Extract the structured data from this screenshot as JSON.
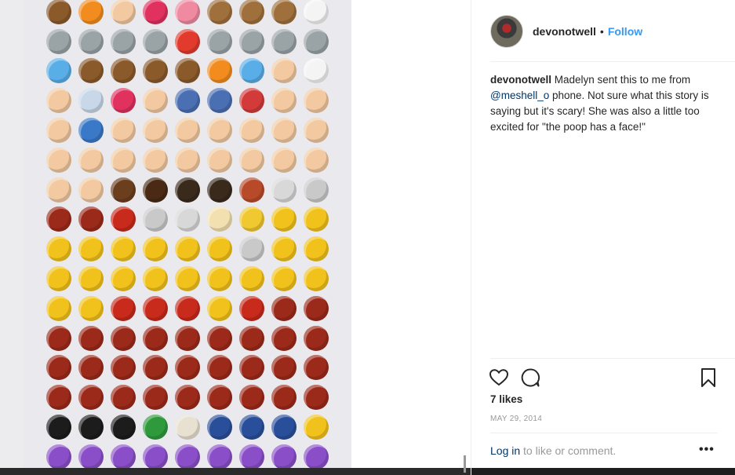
{
  "post": {
    "username": "devonotwell",
    "separator": "•",
    "follow_label": "Follow",
    "caption_username": "devonotwell",
    "caption_before_mention": " Madelyn sent this to me from ",
    "caption_mention": "@meshell_o",
    "caption_after_mention": " phone. Not sure what this story is saying but it's scary! She was also a little too excited for \"the poop has a face!\"",
    "likes": "7 likes",
    "date": "MAY 29, 2014",
    "login_link": "Log in",
    "login_suffix": " to like or comment.",
    "more_label": "•••"
  },
  "icons": {
    "like": "heart-icon",
    "comment": "comment-icon",
    "save": "bookmark-icon",
    "more": "more-options-icon"
  },
  "colors": {
    "accent": "#3897f0",
    "link": "#003569",
    "text": "#262626",
    "muted": "#999999",
    "phone_bg": "#e9e9ee"
  },
  "emoji_rows": [
    [
      "poo",
      "fire",
      "nose",
      "lips",
      "tongue",
      "monkey",
      "monkey",
      "monkey",
      "eyes"
    ],
    [
      "alien",
      "alien",
      "alien",
      "alien",
      "anger",
      "alien",
      "alien",
      "alien",
      "alien"
    ],
    [
      "sweat",
      "poo",
      "poo",
      "poo",
      "poo",
      "fire",
      "droplet",
      "nose",
      "eyes"
    ],
    [
      "ear",
      "dash",
      "lips",
      "wave",
      "runner",
      "runner",
      "dancer",
      "muscle",
      "clap"
    ],
    [
      "point-up",
      "pray",
      "open-hands",
      "open-hands",
      "thumbs-up",
      "ok-hand",
      "fist",
      "fist",
      "fist"
    ],
    [
      "fist",
      "point-down",
      "point-down",
      "point-down",
      "point-down",
      "point-up",
      "muscle",
      "muscle",
      "muscle"
    ],
    [
      "muscle",
      "baby",
      "boy",
      "girl",
      "man",
      "man",
      "woman",
      "older-man",
      "older-woman"
    ],
    [
      "ogre",
      "ogre",
      "goblin",
      "older-woman",
      "older-man",
      "angel",
      "princess",
      "smirk-cat",
      "scream-cat"
    ],
    [
      "crying-cat",
      "joy-cat",
      "smirk-cat",
      "smile-cat",
      "smile-cat",
      "heart-eyes-cat",
      "older-woman",
      "kissing-cat",
      "heart-eyes-cat"
    ],
    [
      "heart-eyes-cat",
      "heart-eyes-cat",
      "heart-eyes-cat",
      "heart-eyes-cat",
      "heart-eyes-cat",
      "heart-eyes-cat",
      "heart-eyes-cat",
      "heart-eyes-cat",
      "heart-eyes-cat"
    ],
    [
      "heart-eyes-cat",
      "heart-eyes-cat",
      "goblin",
      "goblin",
      "goblin",
      "kissing-cat",
      "goblin",
      "ogre",
      "ogre"
    ],
    [
      "ogre",
      "ogre",
      "ogre",
      "ogre",
      "ogre",
      "ogre",
      "ogre",
      "ogre",
      "ogre"
    ],
    [
      "ogre",
      "ogre",
      "ogre",
      "ogre",
      "ogre",
      "ogre",
      "ogre",
      "ogre",
      "ogre"
    ],
    [
      "ogre",
      "ogre",
      "ogre",
      "ogre",
      "ogre",
      "ogre",
      "ogre",
      "ogre",
      "ogre"
    ],
    [
      "guard",
      "guard",
      "guard",
      "man-with-cap",
      "turban",
      "cop",
      "cop",
      "cop",
      "worker"
    ],
    [
      "imp",
      "imp",
      "imp",
      "imp",
      "imp",
      "imp",
      "imp",
      "imp",
      "imp"
    ]
  ],
  "emoji_colors": {
    "poo": "#8b5a2b",
    "fire": "#f28c1e",
    "nose": "#f2c9a0",
    "lips": "#e0315f",
    "tongue": "#f08aa0",
    "monkey": "#a0703c",
    "eyes": "#f4f4f4",
    "alien": "#9aa3a6",
    "anger": "#e23b2e",
    "sweat": "#5aaee8",
    "droplet": "#5aaee8",
    "ear": "#f2c9a0",
    "dash": "#c8d8e8",
    "wave": "#f2c9a0",
    "runner": "#4a6fb3",
    "dancer": "#d33a3a",
    "muscle": "#f2c9a0",
    "clap": "#f2c9a0",
    "point-up": "#f2c9a0",
    "pray": "#3a78c8",
    "open-hands": "#f2c9a0",
    "thumbs-up": "#f2c9a0",
    "ok-hand": "#f2c9a0",
    "fist": "#f2c9a0",
    "point-down": "#f2c9a0",
    "baby": "#f2c9a0",
    "boy": "#6b3e1e",
    "girl": "#4a2a14",
    "man": "#3a2a1c",
    "woman": "#b84a2a",
    "older-man": "#d8d8d8",
    "older-woman": "#c9c9c9",
    "ogre": "#9c2a1a",
    "goblin": "#c82a1c",
    "angel": "#f2e0b0",
    "princess": "#f0c830",
    "smirk-cat": "#f2c21c",
    "scream-cat": "#f2c21c",
    "crying-cat": "#f2c21c",
    "joy-cat": "#f2c21c",
    "smile-cat": "#f2c21c",
    "heart-eyes-cat": "#f2c21c",
    "kissing-cat": "#f2c21c",
    "guard": "#1c1c1c",
    "man-with-cap": "#2f9a3c",
    "turban": "#e8e0d0",
    "cop": "#2a4f9a",
    "worker": "#f2c21c",
    "imp": "#8a4fc8"
  }
}
